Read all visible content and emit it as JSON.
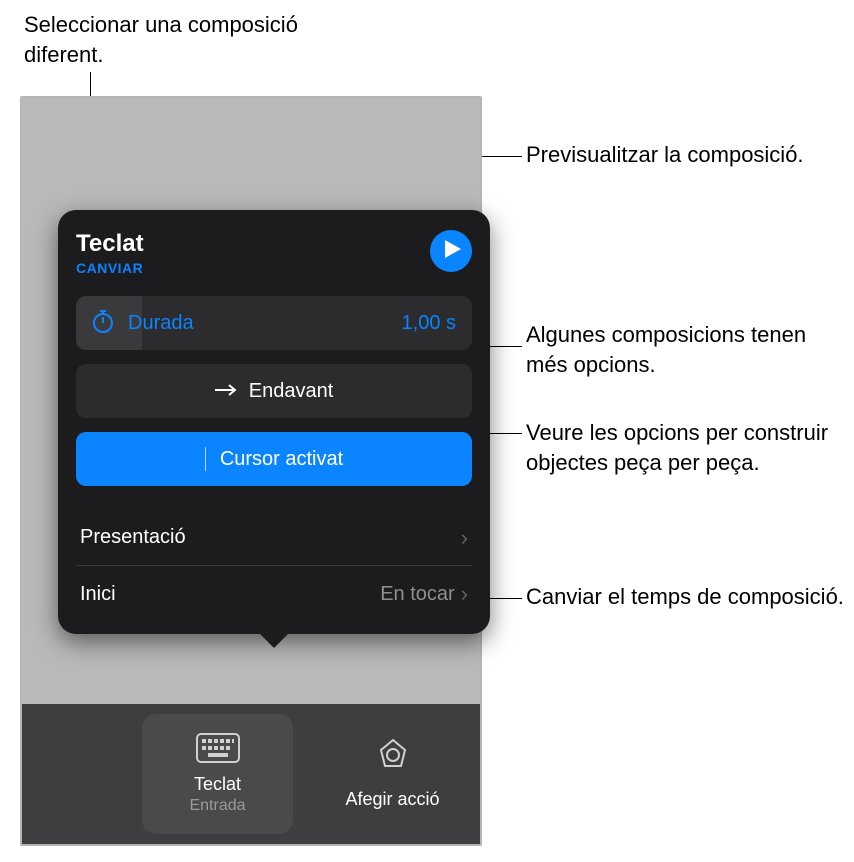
{
  "annotations": {
    "select_different": "Seleccionar una composició diferent.",
    "preview": "Previsualitzar la composició.",
    "more_options": "Algunes composicions tenen més opcions.",
    "piece_by_piece": "Veure les opcions per construir objectes peça per peça.",
    "change_timing": "Canviar el temps de composició."
  },
  "popover": {
    "title": "Teclat",
    "change": "CANVIAR",
    "duration_label": "Durada",
    "duration_value": "1,00 s",
    "direction": "Endavant",
    "cursor": "Cursor activat",
    "presentation": "Presentació",
    "start_label": "Inici",
    "start_value": "En tocar"
  },
  "bottom": {
    "item1_label": "Teclat",
    "item1_sub": "Entrada",
    "item2_label": "Afegir acció"
  }
}
